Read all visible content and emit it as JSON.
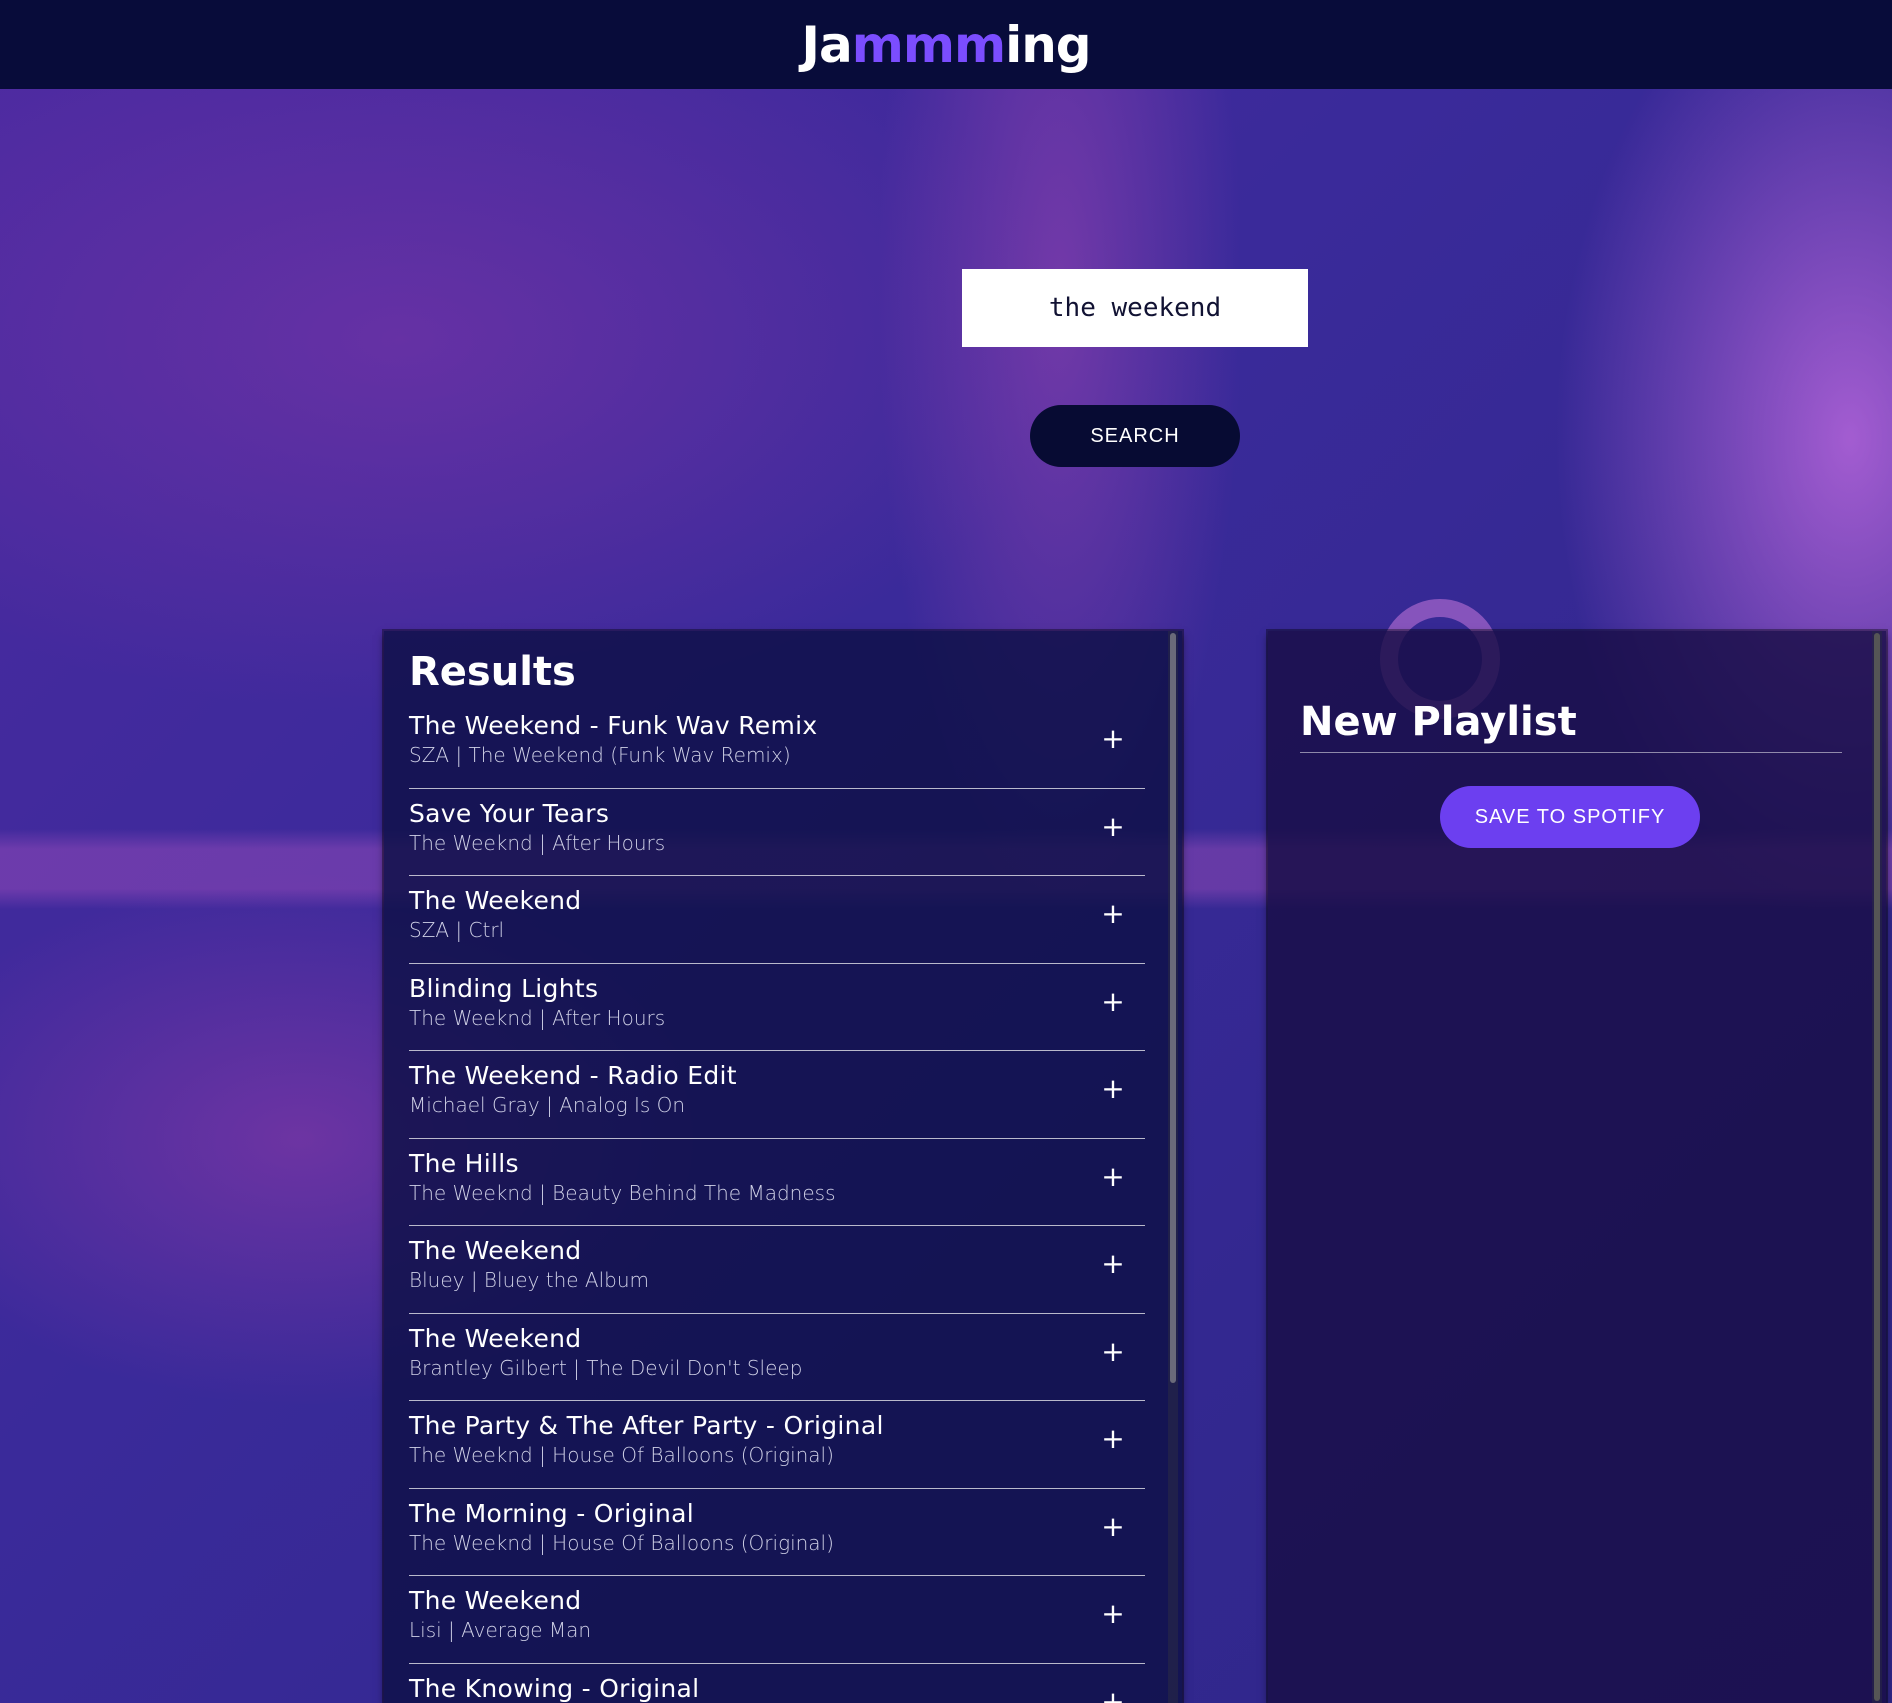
{
  "header": {
    "logo_part1": "Ja",
    "logo_part2": "mmm",
    "logo_part3": "ing"
  },
  "search": {
    "value": "the weekend",
    "button_label": "SEARCH"
  },
  "results": {
    "title": "Results",
    "add_icon": "+",
    "tracks": [
      {
        "name": "The Weekend - Funk Wav Remix",
        "info": "SZA | The Weekend (Funk Wav Remix)"
      },
      {
        "name": "Save Your Tears",
        "info": "The Weeknd | After Hours"
      },
      {
        "name": "The Weekend",
        "info": "SZA | Ctrl"
      },
      {
        "name": "Blinding Lights",
        "info": "The Weeknd | After Hours"
      },
      {
        "name": "The Weekend - Radio Edit",
        "info": "Michael Gray | Analog Is On"
      },
      {
        "name": "The Hills",
        "info": "The Weeknd | Beauty Behind The Madness"
      },
      {
        "name": "The Weekend",
        "info": "Bluey | Bluey the Album"
      },
      {
        "name": "The Weekend",
        "info": "Brantley Gilbert | The Devil Don't Sleep"
      },
      {
        "name": "The Party & The After Party - Original",
        "info": "The Weeknd | House Of Balloons (Original)"
      },
      {
        "name": "The Morning - Original",
        "info": "The Weeknd | House Of Balloons (Original)"
      },
      {
        "name": "The Weekend",
        "info": "Lisi | Average Man"
      },
      {
        "name": "The Knowing - Original",
        "info": ""
      }
    ]
  },
  "playlist": {
    "name": "New Playlist",
    "save_label": "SAVE TO SPOTIFY"
  },
  "colors": {
    "header_bg": "#080c3a",
    "accent": "#6c3ff0",
    "logo_highlight": "#7b4dff"
  }
}
